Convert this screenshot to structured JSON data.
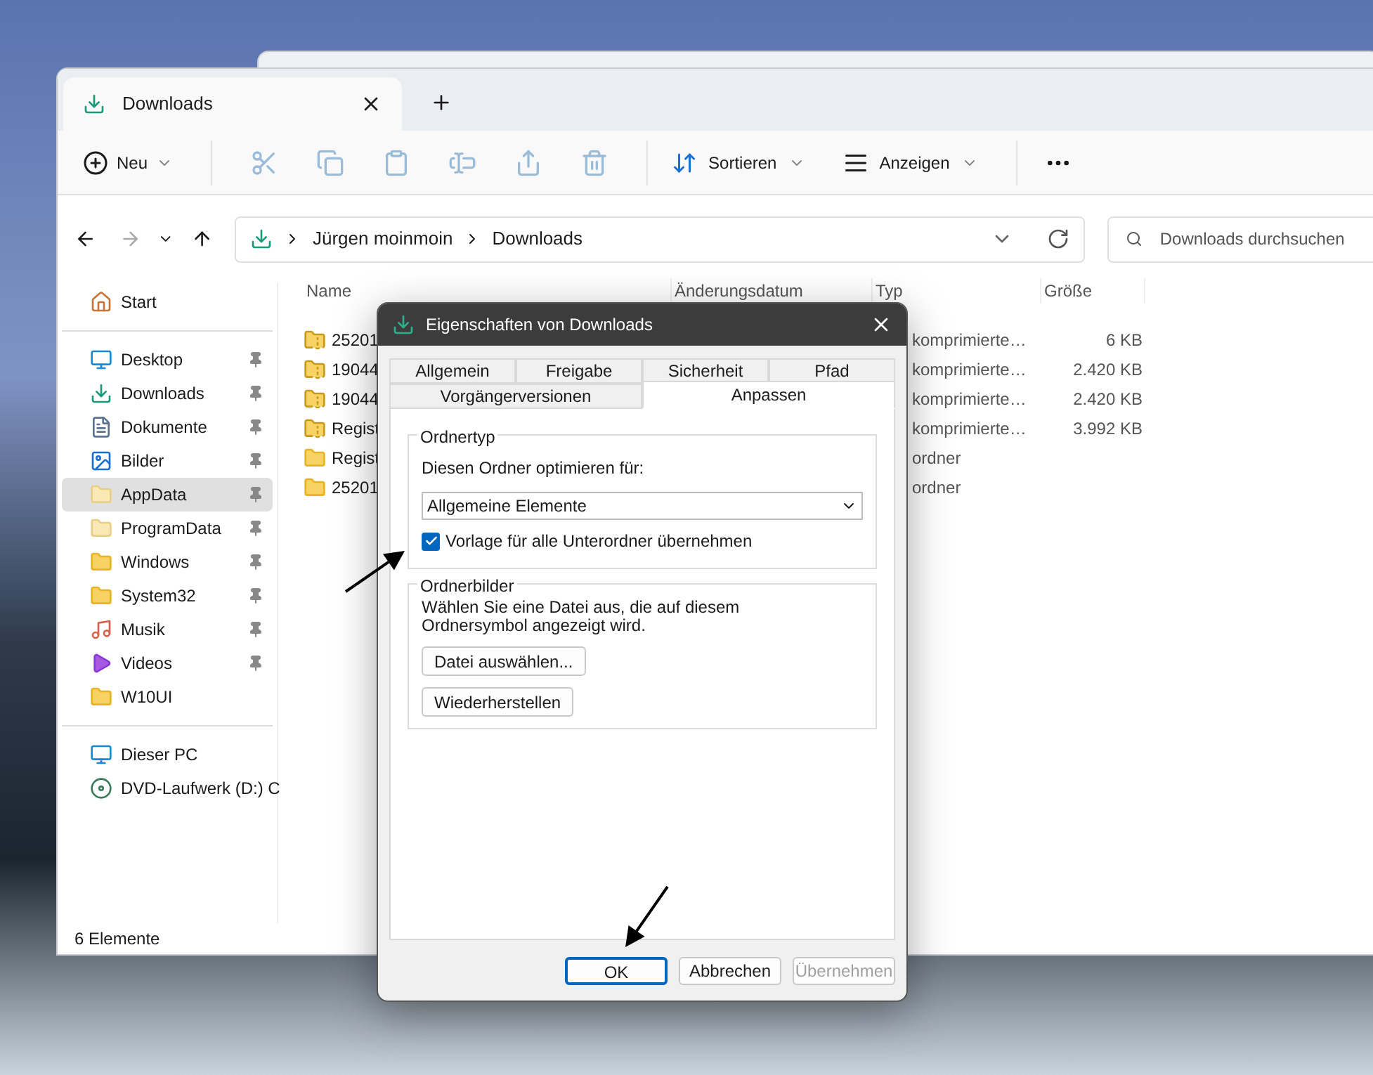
{
  "explorer": {
    "tab": {
      "title": "Downloads"
    },
    "toolbar": {
      "new_label": "Neu",
      "sort_label": "Sortieren",
      "view_label": "Anzeigen"
    },
    "address": {
      "segments": [
        "Jürgen moinmoin",
        "Downloads"
      ]
    },
    "search": {
      "placeholder": "Downloads durchsuchen"
    },
    "sidebar": {
      "groups": [
        [
          {
            "label": "Start",
            "kind": "home",
            "pinned": false,
            "selected": false
          }
        ],
        [
          {
            "label": "Desktop",
            "kind": "desktop",
            "pinned": true,
            "selected": false
          },
          {
            "label": "Downloads",
            "kind": "downloads",
            "pinned": true,
            "selected": false
          },
          {
            "label": "Dokumente",
            "kind": "documents",
            "pinned": true,
            "selected": false
          },
          {
            "label": "Bilder",
            "kind": "pictures",
            "pinned": true,
            "selected": false
          },
          {
            "label": "AppData",
            "kind": "folder-light",
            "pinned": true,
            "selected": true
          },
          {
            "label": "ProgramData",
            "kind": "folder-light",
            "pinned": true,
            "selected": false
          },
          {
            "label": "Windows",
            "kind": "folder",
            "pinned": true,
            "selected": false
          },
          {
            "label": "System32",
            "kind": "folder",
            "pinned": true,
            "selected": false
          },
          {
            "label": "Musik",
            "kind": "music",
            "pinned": true,
            "selected": false
          },
          {
            "label": "Videos",
            "kind": "videos",
            "pinned": true,
            "selected": false
          },
          {
            "label": "W10UI",
            "kind": "folder",
            "pinned": false,
            "selected": false
          }
        ],
        [
          {
            "label": "Dieser PC",
            "kind": "pc",
            "pinned": false,
            "selected": false
          },
          {
            "label": "DVD-Laufwerk (D:) C",
            "kind": "dvd",
            "pinned": false,
            "selected": false
          }
        ]
      ]
    },
    "table": {
      "columns": [
        "Name",
        "Änderungsdatum",
        "Typ",
        "Größe"
      ],
      "rows": [
        {
          "name": "25201",
          "kind": "zip",
          "type": "komprimierte…",
          "size": "6 KB"
        },
        {
          "name": "19044",
          "kind": "zip",
          "type": "komprimierte…",
          "size": "2.420 KB"
        },
        {
          "name": "19044",
          "kind": "zip",
          "type": "komprimierte…",
          "size": "2.420 KB"
        },
        {
          "name": "Regist",
          "kind": "zip",
          "type": "komprimierte…",
          "size": "3.992 KB"
        },
        {
          "name": "Regist",
          "kind": "folder",
          "type": "ordner"
        },
        {
          "name": "25201",
          "kind": "folder",
          "type": "ordner"
        }
      ]
    },
    "status_bar": "6 Elemente"
  },
  "dialog": {
    "title": "Eigenschaften von Downloads",
    "tab_rows": [
      [
        {
          "label": "Allgemein",
          "selected": false
        },
        {
          "label": "Freigabe",
          "selected": false
        },
        {
          "label": "Sicherheit",
          "selected": false
        },
        {
          "label": "Pfad",
          "selected": false
        }
      ],
      [
        {
          "label": "Vorgängerversionen",
          "selected": false
        },
        {
          "label": "Anpassen",
          "selected": true
        }
      ]
    ],
    "folder_type": {
      "legend": "Ordnertyp",
      "label": "Diesen Ordner optimieren für:",
      "value": "Allgemeine Elemente",
      "checkbox": {
        "label": "Vorlage für alle Unterordner übernehmen",
        "checked": true
      }
    },
    "folder_pictures": {
      "legend": "Ordnerbilder",
      "text": "Wählen Sie eine Datei aus, die auf diesem Ordnersymbol angezeigt wird.",
      "buttons": [
        "Datei auswählen...",
        "Wiederherstellen"
      ]
    },
    "buttons": [
      {
        "label": "OK",
        "default": true,
        "disabled": false
      },
      {
        "label": "Abbrechen",
        "default": false,
        "disabled": false
      },
      {
        "label": "Übernehmen",
        "default": false,
        "disabled": true
      }
    ]
  }
}
